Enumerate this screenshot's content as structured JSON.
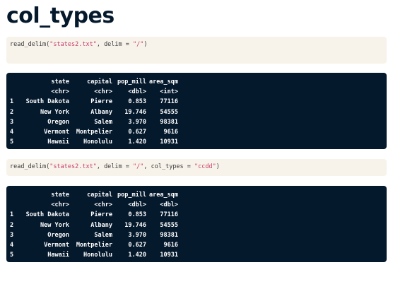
{
  "page_title": "col_types",
  "code1": {
    "fn": "read_delim(",
    "file": "\"states2.txt\"",
    "mid": ", delim = ",
    "delim": "\"/\"",
    "tail": ")"
  },
  "code2": {
    "fn": "read_delim(",
    "file": "\"states2.txt\"",
    "mid": ", delim = ",
    "delim": "\"/\"",
    "mid2": ", col_types = ",
    "types": "\"ccdd\"",
    "tail": ")"
  },
  "output1": {
    "headers": [
      "",
      "state",
      "capital",
      "pop_mill",
      "area_sqm"
    ],
    "types": [
      "",
      "<chr>",
      "<chr>",
      "<dbl>",
      "<int>"
    ],
    "rows": [
      [
        "1",
        "South Dakota",
        "Pierre",
        "0.853",
        "77116"
      ],
      [
        "2",
        "New York",
        "Albany",
        "19.746",
        "54555"
      ],
      [
        "3",
        "Oregon",
        "Salem",
        "3.970",
        "98381"
      ],
      [
        "4",
        "Vermont",
        "Montpelier",
        "0.627",
        "9616"
      ],
      [
        "5",
        "Hawaii",
        "Honolulu",
        "1.420",
        "10931"
      ]
    ]
  },
  "output2": {
    "headers": [
      "",
      "state",
      "capital",
      "pop_mill",
      "area_sqm"
    ],
    "types": [
      "",
      "<chr>",
      "<chr>",
      "<dbl>",
      "<dbl>"
    ],
    "rows": [
      [
        "1",
        "South Dakota",
        "Pierre",
        "0.853",
        "77116"
      ],
      [
        "2",
        "New York",
        "Albany",
        "19.746",
        "54555"
      ],
      [
        "3",
        "Oregon",
        "Salem",
        "3.970",
        "98381"
      ],
      [
        "4",
        "Vermont",
        "Montpelier",
        "0.627",
        "9616"
      ],
      [
        "5",
        "Hawaii",
        "Honolulu",
        "1.420",
        "10931"
      ]
    ]
  },
  "colors": {
    "title": "#05192d",
    "code_bg": "#f7f3eb",
    "string": "#c83d6a",
    "output_bg": "#05192d",
    "output_text": "#ffffff"
  }
}
